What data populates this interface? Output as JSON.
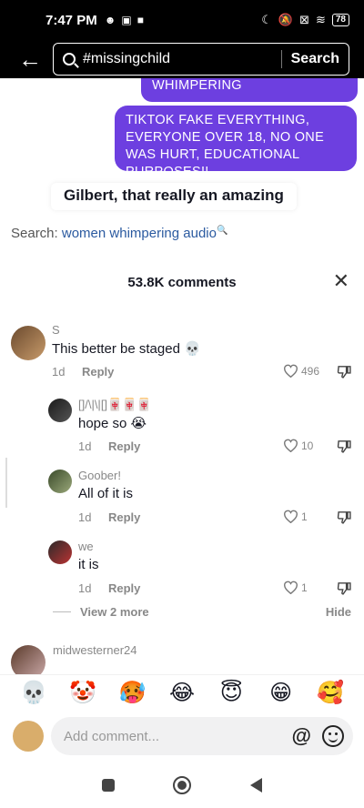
{
  "status_bar": {
    "time": "7:47 PM",
    "battery": "78"
  },
  "search": {
    "query": "#missingchild",
    "button": "Search"
  },
  "video": {
    "bubble_top": "WHIMPERING",
    "bubble_main": "TIKTOK FAKE EVERYTHING, EVERYONE OVER 18, NO ONE WAS HURT, EDUCATIONAL PURPOSES!!",
    "caption": "Gilbert, that really an amazing",
    "search_prefix": "Search:",
    "search_term": "women whimpering audio"
  },
  "comments": {
    "count_label": "53.8K comments",
    "items": [
      {
        "name": "S",
        "text": "This better be staged 💀",
        "date": "1d",
        "reply": "Reply",
        "likes": "496"
      },
      {
        "name": "[]/\\|\\|[]🀄🀄🀄",
        "text": "hope so 😭",
        "date": "1d",
        "reply": "Reply",
        "likes": "10"
      },
      {
        "name": "Goober!",
        "text": "All of it is",
        "date": "1d",
        "reply": "Reply",
        "likes": "1"
      },
      {
        "name": "we",
        "text": "it is",
        "date": "1d",
        "reply": "Reply",
        "likes": "1"
      }
    ],
    "view_more": "View 2 more",
    "hide": "Hide",
    "next_name": "midwesterner24"
  },
  "emoji_bar": [
    "💀",
    "🤡",
    "🥵",
    "😂",
    "😇",
    "😁",
    "🥰"
  ],
  "input": {
    "placeholder": "Add comment...",
    "at_symbol": "@"
  },
  "colors": {
    "accent_purple": "#6d3fe0",
    "link_blue": "#2b5aa0"
  }
}
